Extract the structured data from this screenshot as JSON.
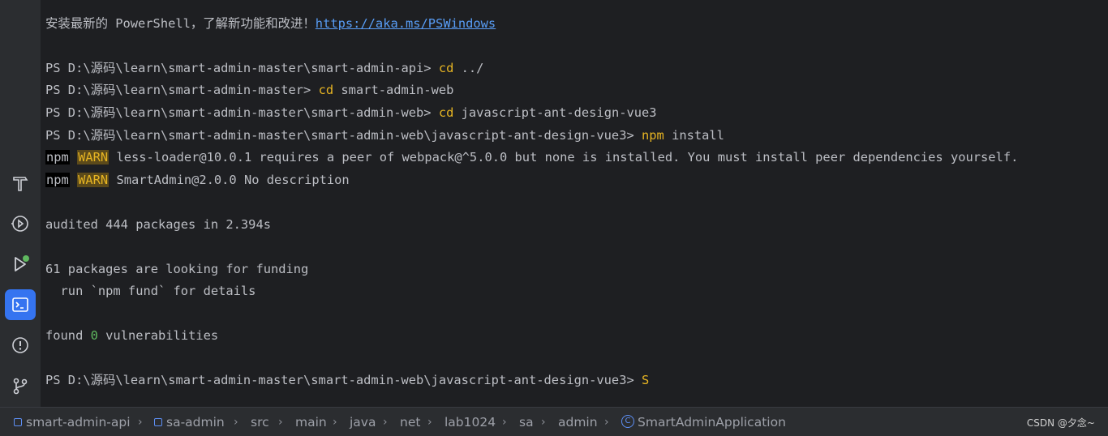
{
  "terminal": {
    "promo_text": "安装最新的 PowerShell，了解新功能和改进！",
    "promo_link": "https://aka.ms/PSWindows",
    "lines": [
      {
        "prompt": "PS D:\\源码\\learn\\smart-admin-master\\smart-admin-api> ",
        "cmd": "cd",
        "rest": " ../"
      },
      {
        "prompt": "PS D:\\源码\\learn\\smart-admin-master> ",
        "cmd": "cd",
        "rest": " smart-admin-web"
      },
      {
        "prompt": "PS D:\\源码\\learn\\smart-admin-master\\smart-admin-web> ",
        "cmd": "cd",
        "rest": " javascript-ant-design-vue3"
      },
      {
        "prompt": "PS D:\\源码\\learn\\smart-admin-master\\smart-admin-web\\javascript-ant-design-vue3> ",
        "cmd": "npm",
        "rest": " install"
      }
    ],
    "warn1": {
      "npm": "npm",
      "warn": "WARN",
      "text": " less-loader@10.0.1 requires a peer of webpack@^5.0.0 but none is installed. You must install peer dependencies yourself."
    },
    "warn2": {
      "npm": "npm",
      "warn": "WARN",
      "text": " SmartAdmin@2.0.0 No description"
    },
    "audited": "audited 444 packages in 2.394s",
    "funding1": "61 packages are looking for funding",
    "funding2": "  run `npm fund` for details",
    "found_prefix": "found ",
    "found_count": "0",
    "found_suffix": " vulnerabilities",
    "final_prompt": "PS D:\\源码\\learn\\smart-admin-master\\smart-admin-web\\javascript-ant-design-vue3> ",
    "final_input": "S"
  },
  "sidebar": {
    "icons": [
      "hammer-icon",
      "services-icon",
      "run-icon",
      "terminal-icon",
      "problems-icon",
      "git-icon"
    ],
    "active": "terminal-icon"
  },
  "breadcrumb": {
    "items": [
      "smart-admin-api",
      "sa-admin",
      "src",
      "main",
      "java",
      "net",
      "lab1024",
      "sa",
      "admin",
      "SmartAdminApplication"
    ]
  },
  "watermark": "CSDN @夕念~",
  "colors": {
    "accent": "#3574f0",
    "command": "#e6b422",
    "link": "#589df6",
    "success": "#5fb85f"
  }
}
